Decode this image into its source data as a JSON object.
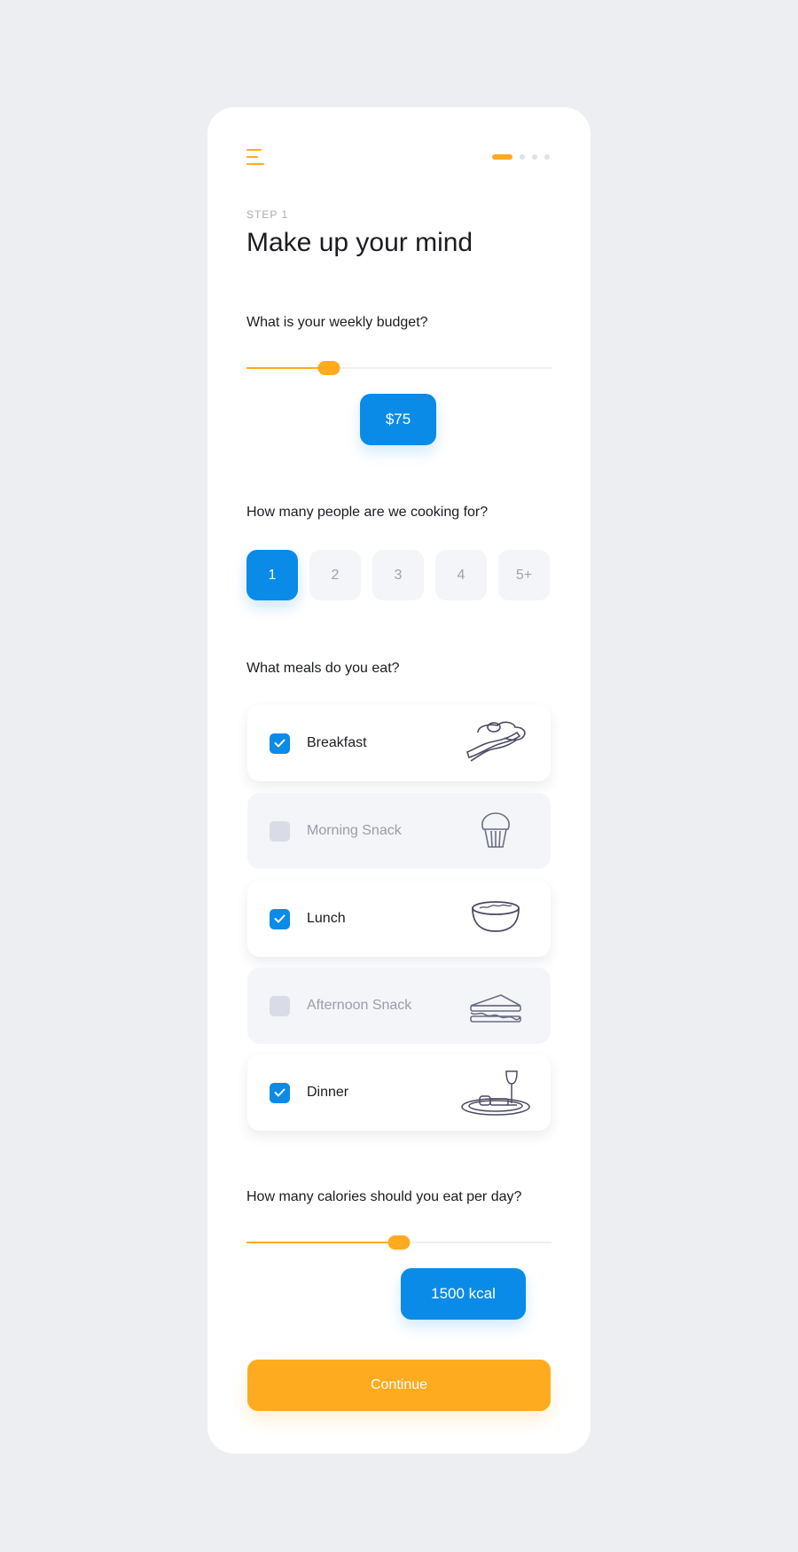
{
  "header": {
    "menu_icon": "hamburger-menu-icon",
    "progress": {
      "current_step": 1,
      "total_steps": 4
    }
  },
  "step_label": "STEP 1",
  "title": "Make up your mind",
  "budget": {
    "question": "What is your weekly budget?",
    "value_label": "$75",
    "slider_fraction": 0.27
  },
  "people": {
    "question": "How many people are we cooking for?",
    "options": [
      "1",
      "2",
      "3",
      "4",
      "5+"
    ],
    "selected": "1"
  },
  "meals": {
    "question": "What meals do you eat?",
    "items": [
      {
        "label": "Breakfast",
        "checked": true,
        "icon": "bacon-and-egg-icon"
      },
      {
        "label": "Morning Snack",
        "checked": false,
        "icon": "muffin-icon"
      },
      {
        "label": "Lunch",
        "checked": true,
        "icon": "bowl-icon"
      },
      {
        "label": "Afternoon Snack",
        "checked": false,
        "icon": "sandwich-icon"
      },
      {
        "label": "Dinner",
        "checked": true,
        "icon": "dinner-plate-icon"
      }
    ]
  },
  "calories": {
    "question": "How many calories should you eat per day?",
    "value_label": "1500 kcal",
    "slider_fraction": 0.5
  },
  "continue_label": "Continue",
  "colors": {
    "accent": "#ffab1f",
    "primary": "#0a8be8",
    "background": "#edeef2"
  }
}
